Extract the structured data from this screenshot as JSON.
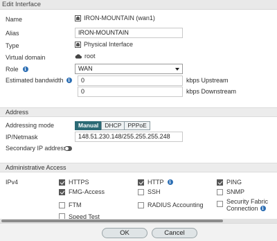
{
  "dialog": {
    "title": "Edit Interface"
  },
  "fields": {
    "name_label": "Name",
    "name_value": "IRON-MOUNTAIN (wan1)",
    "alias_label": "Alias",
    "alias_value": "IRON-MOUNTAIN",
    "type_label": "Type",
    "type_value": "Physical Interface",
    "vdom_label": "Virtual domain",
    "vdom_value": "root",
    "role_label": "Role",
    "role_value": "WAN",
    "bandwidth_label": "Estimated bandwidth",
    "upstream_value": "0",
    "upstream_unit": "kbps Upstream",
    "downstream_value": "0",
    "downstream_unit": "kbps Downstream"
  },
  "address": {
    "section_title": "Address",
    "mode_label": "Addressing mode",
    "modes": [
      "Manual",
      "DHCP",
      "PPPoE"
    ],
    "selected_mode": "Manual",
    "ip_label": "IP/Netmask",
    "ip_value": "148.51.230.148/255.255.255.248",
    "secondary_label": "Secondary IP address"
  },
  "admin_access": {
    "section_title": "Administrative Access",
    "ipv4_label": "IPv4",
    "options": {
      "https": {
        "label": "HTTPS",
        "checked": true
      },
      "http": {
        "label": "HTTP",
        "checked": true
      },
      "ping": {
        "label": "PING",
        "checked": true
      },
      "fmg": {
        "label": "FMG-Access",
        "checked": true
      },
      "ssh": {
        "label": "SSH",
        "checked": false
      },
      "snmp": {
        "label": "SNMP",
        "checked": false
      },
      "ftm": {
        "label": "FTM",
        "checked": false
      },
      "radius": {
        "label": "RADIUS Accounting",
        "checked": false
      },
      "fabric_line1": {
        "label": "Security Fabric",
        "checked": false
      },
      "fabric_line2": "Connection",
      "speed": {
        "label": "Speed Test",
        "checked": false
      }
    }
  },
  "footer": {
    "ok_label": "OK",
    "cancel_label": "Cancel"
  },
  "colors": {
    "accent": "#2b6a75",
    "info": "#2d6fb4",
    "section_bg": "#ececec"
  }
}
